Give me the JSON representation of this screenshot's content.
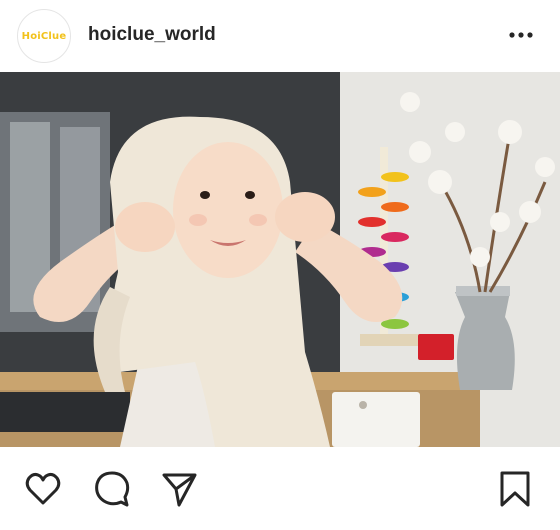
{
  "post": {
    "avatar_text": "HoiClue",
    "username": "hoiclue_world"
  },
  "icons": {
    "more": "more-horizontal-icon",
    "like": "heart-icon",
    "comment": "comment-bubble-icon",
    "share": "paper-plane-icon",
    "save": "bookmark-icon"
  },
  "colors": {
    "brand_yellow": "#f2c21b",
    "text": "#262626"
  }
}
